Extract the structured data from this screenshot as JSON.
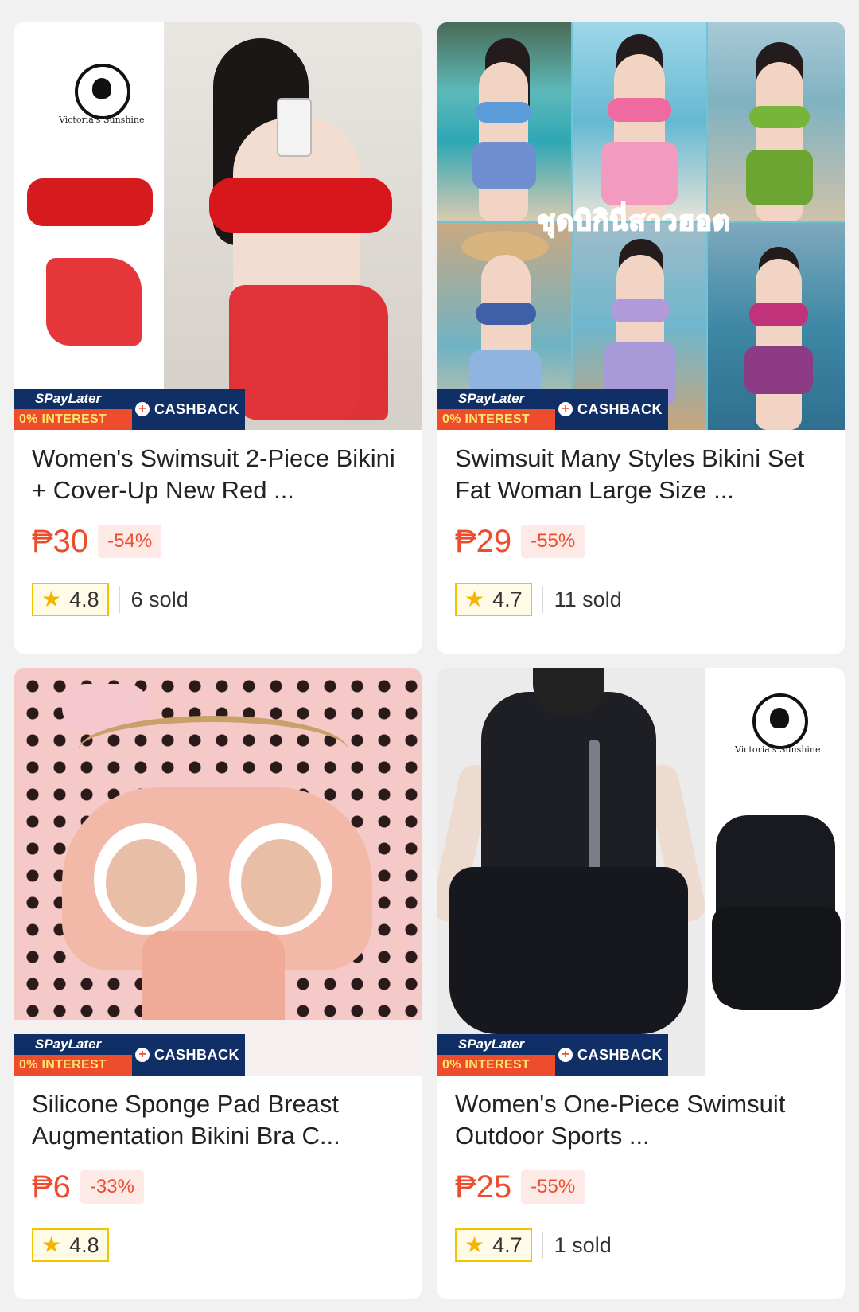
{
  "products": [
    {
      "title": "Women's Swimsuit 2-Piece Bikini + Cover-Up New Red ...",
      "price": "₱30",
      "discount": "-54%",
      "rating": "4.8",
      "sold": "6 sold",
      "brand_logo_text": "Victoria's Sunshine"
    },
    {
      "title": "Swimsuit Many Styles Bikini Set Fat Woman Large Size ...",
      "price": "₱29",
      "discount": "-55%",
      "rating": "4.7",
      "sold": "11 sold",
      "image_overlay_text": "ชุดบิกินี่สาวฮอต"
    },
    {
      "title": "Silicone Sponge Pad Breast Augmentation Bikini Bra C...",
      "price": "₱6",
      "discount": "-33%",
      "rating": "4.8",
      "sold": ""
    },
    {
      "title": "Women's One-Piece Swimsuit Outdoor Sports ...",
      "price": "₱25",
      "discount": "-55%",
      "rating": "4.7",
      "sold": "1 sold",
      "brand_logo_text": "Victoria's Sunshine"
    }
  ],
  "promo": {
    "spaylater": "SPayLater",
    "interest": "0% INTEREST",
    "cashback": "CASHBACK",
    "plus": "+"
  },
  "icons": {
    "rating": "star-icon",
    "cashback": "plus-circle-icon"
  },
  "colors": {
    "accent": "#ee4d2d",
    "promo_navy": "#0f2f66",
    "star": "#f5b400"
  }
}
